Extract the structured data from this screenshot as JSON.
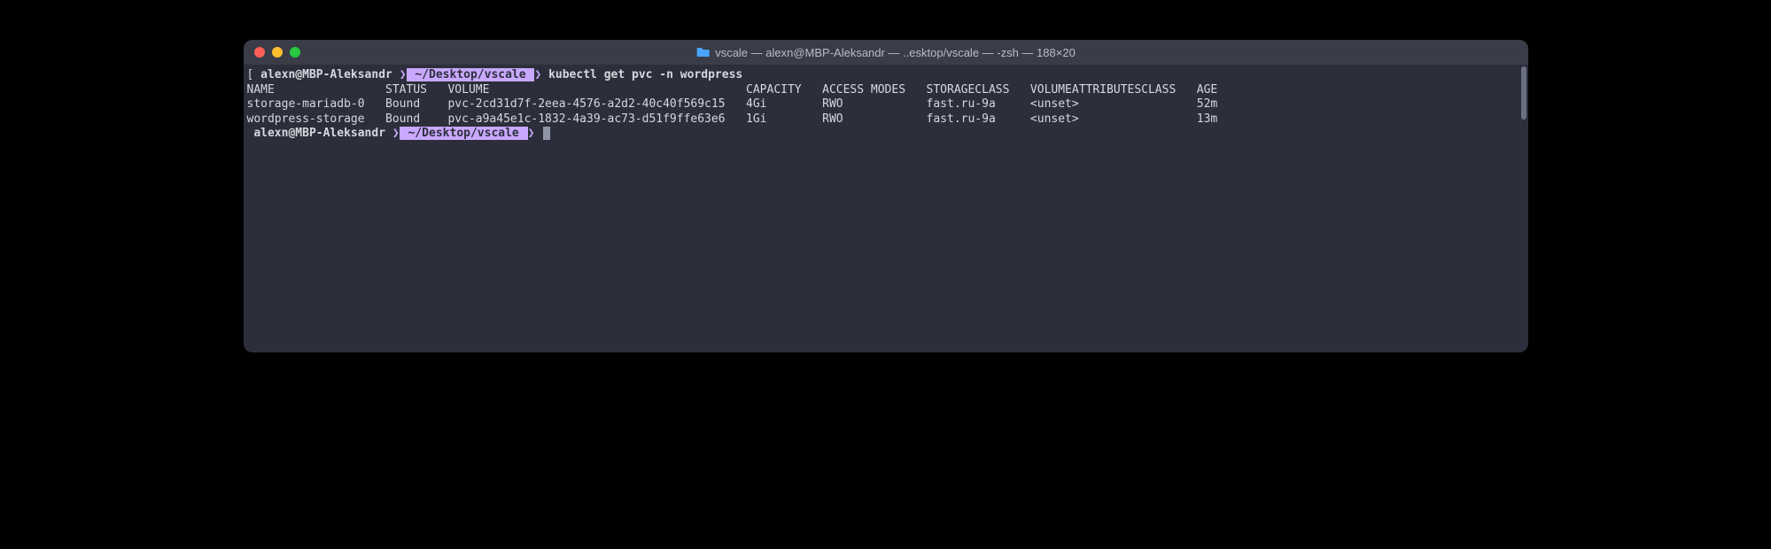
{
  "window": {
    "title": "vscale — alexn@MBP-Aleksandr — ..esktop/vscale — -zsh — 188×20"
  },
  "prompt1": {
    "open_bracket": "[",
    "user": " alexn@MBP-Aleksandr ",
    "sep1": "❯",
    "path": " ~/Desktop/vscale ",
    "sep2": "❯",
    "command": " kubectl get pvc -n wordpress"
  },
  "table": {
    "headers": {
      "name": "NAME",
      "status": "STATUS",
      "volume": "VOLUME",
      "capacity": "CAPACITY",
      "access_modes": "ACCESS MODES",
      "storageclass": "STORAGECLASS",
      "volattr": "VOLUMEATTRIBUTESCLASS",
      "age": "AGE"
    },
    "rows": [
      {
        "name": "storage-mariadb-0",
        "status": "Bound",
        "volume": "pvc-2cd31d7f-2eea-4576-a2d2-40c40f569c15",
        "capacity": "4Gi",
        "access_modes": "RWO",
        "storageclass": "fast.ru-9a",
        "volattr": "<unset>",
        "age": "52m"
      },
      {
        "name": "wordpress-storage",
        "status": "Bound",
        "volume": "pvc-a9a45e1c-1832-4a39-ac73-d51f9ffe63e6",
        "capacity": "1Gi",
        "access_modes": "RWO",
        "storageclass": "fast.ru-9a",
        "volattr": "<unset>",
        "age": "13m"
      }
    ]
  },
  "prompt2": {
    "user": " alexn@MBP-Aleksandr ",
    "sep1": "❯",
    "path": " ~/Desktop/vscale ",
    "sep2": "❯"
  }
}
